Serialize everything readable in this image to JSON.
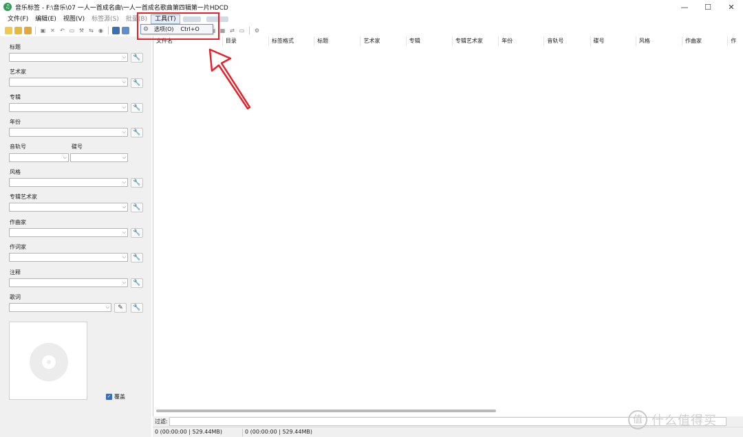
{
  "window": {
    "title": "音乐标签 - F:\\音乐\\07 一人一首成名曲\\一人一首成名歌曲第四辑第一片HDCD",
    "app_icon": "music-note-icon",
    "controls": [
      "minimize",
      "maximize",
      "close"
    ]
  },
  "menubar": {
    "items": [
      {
        "label": "文件(F)",
        "enabled": true
      },
      {
        "label": "编辑(E)",
        "enabled": true
      },
      {
        "label": "视图(V)",
        "enabled": true
      },
      {
        "label": "标签源(S)",
        "enabled": false
      },
      {
        "label": "批量(B)",
        "enabled": false
      },
      {
        "label": "工具(T)",
        "enabled": true,
        "active": true
      }
    ]
  },
  "tools_menu": {
    "items": [
      {
        "icon": "gear-icon",
        "label": "选项(O)",
        "shortcut": "Ctrl+O"
      }
    ]
  },
  "left_panel": {
    "fields": {
      "title": "标题",
      "artist": "艺术家",
      "album": "专辑",
      "year": "年份",
      "track": "音轨号",
      "disc": "碟号",
      "genre": "风格",
      "album_artist": "专辑艺术家",
      "composer": "作曲家",
      "lyricist": "作词家",
      "comment": "注释",
      "lyrics": "歌词"
    },
    "overwrite_label": "覆盖",
    "overwrite_checked": true
  },
  "file_list": {
    "columns": [
      "文件名",
      "目录",
      "标签格式",
      "标题",
      "艺术家",
      "专辑",
      "专辑艺术家",
      "年份",
      "音轨号",
      "碟号",
      "风格",
      "作曲家",
      "作"
    ]
  },
  "filter": {
    "label": "过滤:"
  },
  "status": {
    "left": "0 (00:00:00 | 529.44MB)",
    "right": "0 (00:00:00 | 529.44MB)"
  },
  "watermark": {
    "symbol": "值",
    "text": "什么值得买"
  },
  "colors": {
    "annotation_red": "#e8202a",
    "menu_highlight": "#e5eef8",
    "panel_bg": "#f0f0f0"
  }
}
